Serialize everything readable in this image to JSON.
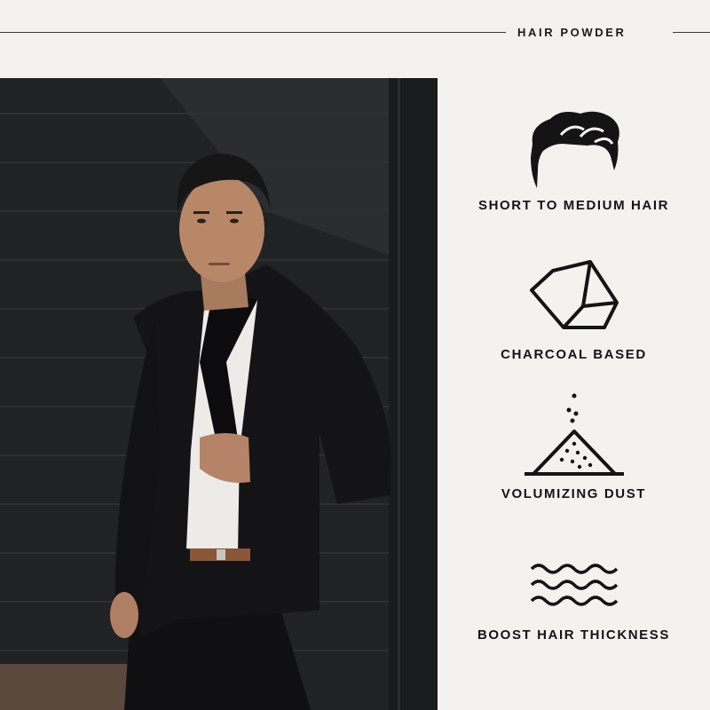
{
  "header": {
    "title": "HAIR POWDER"
  },
  "features": [
    {
      "icon": "hair-icon",
      "label": "SHORT TO MEDIUM HAIR"
    },
    {
      "icon": "charcoal-icon",
      "label": "CHARCOAL BASED"
    },
    {
      "icon": "dust-icon",
      "label": "VOLUMIZING DUST"
    },
    {
      "icon": "wave-icon",
      "label": "BOOST HAIR THICKNESS"
    }
  ],
  "colors": {
    "background": "#f3f2ef",
    "text": "#141414",
    "photo_dark": "#1c1d1f"
  }
}
